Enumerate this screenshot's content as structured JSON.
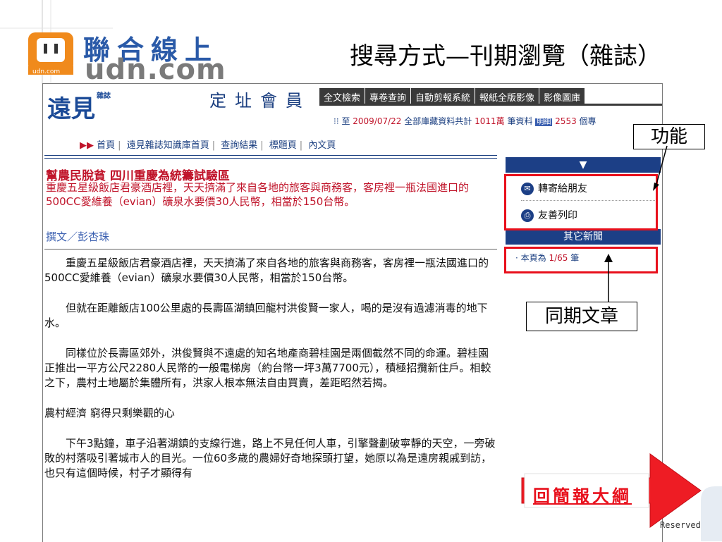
{
  "logo": {
    "badge_text": "udn.com",
    "name_cn": "聯合線上",
    "name_en": "udn.com"
  },
  "slide_title": "搜尋方式—刊期瀏覽（雜誌）",
  "site": {
    "logo_text": "遠見",
    "logo_small": "雜誌",
    "member_label": "定址會員",
    "top_nav": [
      "全文檢索",
      "專卷查詢",
      "自動剪報系統",
      "報紙全版影像",
      "影像圖庫"
    ],
    "info": {
      "prefix": "⁝⁝ 至",
      "date": "2009/07/22",
      "mid": "全部庫藏資料共計",
      "count1": "1011萬",
      "mid2": "筆資料",
      "badge": "明細",
      "count2": "2553",
      "suffix": "個專"
    },
    "breadcrumb": [
      "首頁",
      "遠見雜誌知識庫首頁",
      "查詢結果",
      "標題頁",
      "內文頁"
    ]
  },
  "article": {
    "title": "幫農民脫貧 四川重慶為統籌試驗區",
    "lead": "重慶五星級飯店君豪酒店裡，天天擠滿了來自各地的旅客與商務客，客房裡一瓶法國進口的500CC愛維養（evian）礦泉水要價30人民幣，相當於150台幣。",
    "author": "撰文／彭杏珠",
    "paragraphs": [
      "重慶五星級飯店君豪酒店裡，天天擠滿了來自各地的旅客與商務客，客房裡一瓶法國進口的500CC愛維養（evian）礦泉水要價30人民幣，相當於150台幣。",
      "但就在距離飯店100公里處的長壽區湖鎮回龍村洪俊賢一家人，喝的是沒有過濾消毒的地下水。",
      "同樣位於長壽區郊外，洪俊賢與不遠處的知名地產商碧桂園是兩個截然不同的命運。碧桂園正推出一平方公尺2280人民幣的一般電梯房（約台幣一坪3萬7700元），積極招攬新住戶。相較之下，農村土地屬於集體所有，洪家人根本無法自由買賣，差距昭然若揭。",
      "農村經濟 窮得只剩樂觀的心",
      "下午3點鐘，車子沿著湖鎮的支線行進，路上不見任何人車，引擎聲劃破寧靜的天空，一旁破敗的村落吸引著城市人的目光。一位60多歲的農婦好奇地探頭打望，她原以為是遠房親戚到訪，也只有這個時候，村子才顯得有"
    ]
  },
  "sidebar": {
    "head_arrow": "▼",
    "items": [
      {
        "icon": "email-icon",
        "label": "轉寄給朋友"
      },
      {
        "icon": "printer-icon",
        "label": "友善列印"
      }
    ],
    "other_news": "其它新聞",
    "page_info": {
      "prefix": "· 本頁為",
      "value": "1/65",
      "suffix": "筆"
    }
  },
  "annotations": {
    "callout_function": "功能",
    "callout_same_issue": "同期文章",
    "back_button": "回簡報大綱"
  },
  "footer_reserved": "Reserved.",
  "colors": {
    "brand_blue": "#1c3f86",
    "accent_red": "#c0142a",
    "annotation_red": "#e8101c"
  }
}
